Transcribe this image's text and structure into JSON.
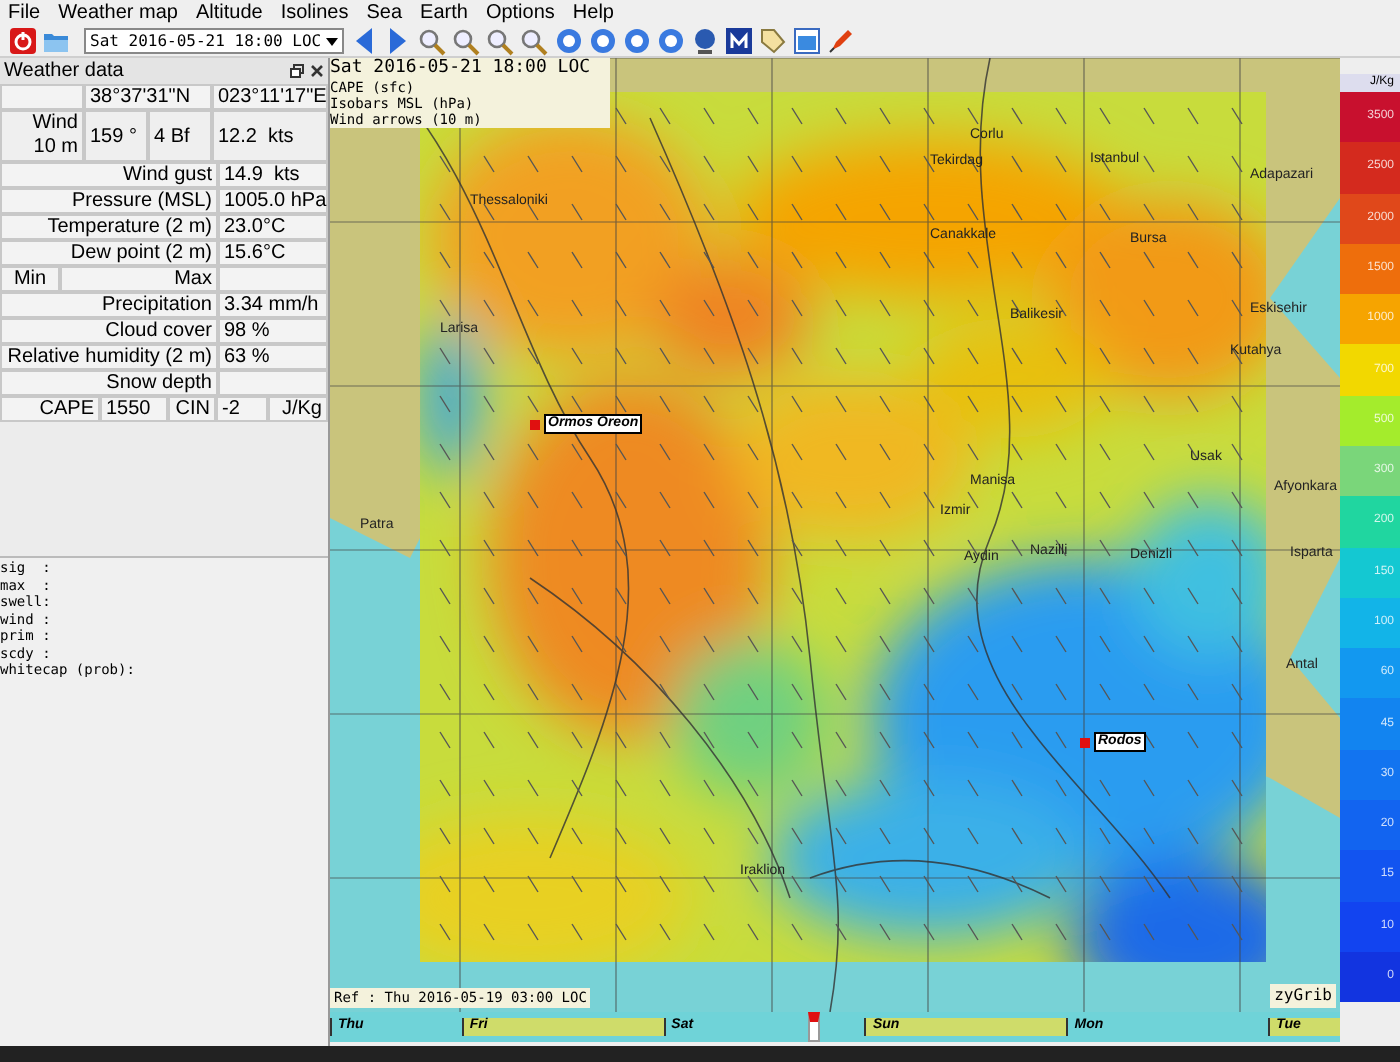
{
  "menu": [
    "File",
    "Weather map",
    "Altitude",
    "Isolines",
    "Sea",
    "Earth",
    "Options",
    "Help"
  ],
  "toolbar": {
    "date_combo": "Sat 2016-05-21 18:00 LOC"
  },
  "weather_data": {
    "title": "Weather data",
    "latitude": "38°37'31\"N",
    "longitude": "023°11'17\"E",
    "wind": {
      "label": "Wind 10 m",
      "direction": "159 °",
      "force": "4 Bf",
      "speed": "12.2  kts"
    },
    "rows": [
      {
        "label": "Wind gust",
        "value": "14.9  kts"
      },
      {
        "label": "Pressure (MSL)",
        "value": "1005.0 hPa"
      },
      {
        "label": "Temperature (2 m)",
        "value": "23.0°C"
      },
      {
        "label": "Dew point (2 m)",
        "value": "15.6°C"
      }
    ],
    "min_label": "Min",
    "max_label": "Max",
    "rows2": [
      {
        "label": "Precipitation",
        "value": "3.34 mm/h"
      },
      {
        "label": "Cloud cover",
        "value": "98 %"
      },
      {
        "label": "Relative humidity (2 m)",
        "value": "63 %"
      },
      {
        "label": "Snow depth"
      }
    ],
    "cape": {
      "label": "CAPE",
      "value": "1550",
      "cin_label": "CIN",
      "cin_value": "-2",
      "unit": "J/Kg"
    },
    "wave_lines": [
      "sig  :",
      "max  :",
      "swell:",
      "wind :",
      "prim :",
      "scdy :",
      "whitecap (prob):"
    ]
  },
  "map": {
    "overlay_lines": [
      "Sat 2016-05-21 18:00 LOC",
      "CAPE (sfc)",
      "Isobars MSL (hPa)",
      "Wind arrows (10 m)"
    ],
    "places": [
      {
        "name": "Corlu",
        "marked": false
      },
      {
        "name": "Tekirdag",
        "marked": false
      },
      {
        "name": "Istanbul",
        "marked": false
      },
      {
        "name": "Adapazari",
        "marked": false
      },
      {
        "name": "Thessaloniki",
        "marked": false
      },
      {
        "name": "Canakkale",
        "marked": false
      },
      {
        "name": "Bursa",
        "marked": false
      },
      {
        "name": "Balikesir",
        "marked": false
      },
      {
        "name": "Eskisehir",
        "marked": false
      },
      {
        "name": "Kutahya",
        "marked": false
      },
      {
        "name": "Larisa",
        "marked": false
      },
      {
        "name": "Ormos Oreon",
        "marked": true
      },
      {
        "name": "Usak",
        "marked": false
      },
      {
        "name": "Afyonkara",
        "marked": false
      },
      {
        "name": "Manisa",
        "marked": false
      },
      {
        "name": "Izmir",
        "marked": false
      },
      {
        "name": "Aydin",
        "marked": false
      },
      {
        "name": "Nazilli",
        "marked": false
      },
      {
        "name": "Denizli",
        "marked": false
      },
      {
        "name": "Isparta",
        "marked": false
      },
      {
        "name": "Antal",
        "marked": false
      },
      {
        "name": "Patra",
        "marked": false
      },
      {
        "name": "Rodos",
        "marked": true
      },
      {
        "name": "Iraklion",
        "marked": false
      }
    ],
    "ref": "Ref : Thu 2016-05-19 03:00 LOC",
    "brand": "zyGrib"
  },
  "legend": {
    "unit": "J/Kg",
    "steps": [
      {
        "label": "3500",
        "color": "#c8102e"
      },
      {
        "label": "2500",
        "color": "#d42a1e"
      },
      {
        "label": "2000",
        "color": "#e0481a"
      },
      {
        "label": "1500",
        "color": "#ee6e0c"
      },
      {
        "label": "1000",
        "color": "#f6a400"
      },
      {
        "label": "700",
        "color": "#f2d800"
      },
      {
        "label": "500",
        "color": "#a4ec2c"
      },
      {
        "label": "300",
        "color": "#7ad67a"
      },
      {
        "label": "200",
        "color": "#20d6a0"
      },
      {
        "label": "150",
        "color": "#14c8d2"
      },
      {
        "label": "100",
        "color": "#12b4e8"
      },
      {
        "label": "60",
        "color": "#1298f0"
      },
      {
        "label": "45",
        "color": "#1284f0"
      },
      {
        "label": "30",
        "color": "#1274f0"
      },
      {
        "label": "20",
        "color": "#1264f0"
      },
      {
        "label": "15",
        "color": "#1254f0"
      },
      {
        "label": "10",
        "color": "#1244f0"
      },
      {
        "label": "0",
        "color": "#1234e0"
      }
    ]
  },
  "timeline": {
    "days": [
      "Thu",
      "Fri",
      "Sat",
      "Sun",
      "Mon",
      "Tue"
    ],
    "level": 0.48
  }
}
